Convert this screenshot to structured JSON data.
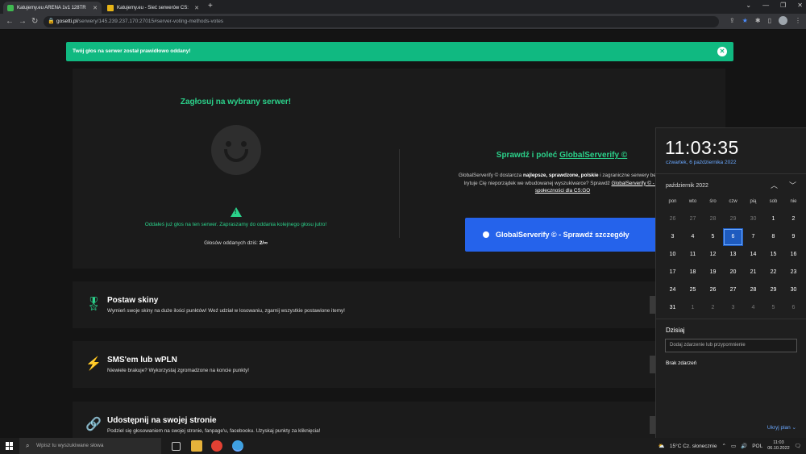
{
  "browser": {
    "tabs": [
      {
        "title": "Katujemy.eu ARENA 1v1 128TR",
        "active": true
      },
      {
        "title": "Katujemy.eu - Sieć serwerów CS:",
        "active": false
      }
    ],
    "url_domain": "gosetti.pl",
    "url_path": "/serwery/145.239.237.170:27015#server-voting-methods-votes"
  },
  "alert": {
    "text": "Twój głos na serwer został prawidłowo oddany!"
  },
  "vote": {
    "title": "Zagłosuj na wybrany serwer!",
    "already_voted": "Oddałeś już głos na ten serwer. Zapraszamy do oddania kolejnego głosu jutro!",
    "votes_today_label": "Głosów oddanych dziś:",
    "votes_today_value": "2/∞"
  },
  "globalserverify": {
    "title_prefix": "Sprawdź i poleć",
    "title_link": "GlobalServerify ©",
    "desc_1": "GlobalServerify © dostarcza",
    "desc_bold": "najlepsze, sprawdzone, polskie",
    "desc_2": "i zagraniczne serwery bezpoś",
    "desc_3": "Irytuje Cię nieporządek we wbudowanej wyszukiwarce? Sprawdź",
    "desc_link": "GlobalServerify © - do",
    "desc_link2": "społeczności dla CS:GO",
    "button": "GlobalServerify © - Sprawdź szczegóły"
  },
  "cards": [
    {
      "title": "Postaw skiny",
      "desc": "Wymień swoje skiny na duże ilości punktów! Weź udział w losowaniu, zgarnij wszystkie postawione itemy!",
      "icon": "award-icon"
    },
    {
      "title": "SMS'em lub wPLN",
      "desc": "Niewiele brakuje? Wykorzystaj zgromadzone na koncie punkty!",
      "icon": "bolt-icon"
    },
    {
      "title": "Udostępnij na swojej stronie",
      "desc": "Podziel się głosowaniem na swojej stronie, fanpage'u, facebooku. Uzyskaj punkty za kliknięcia!",
      "icon": "link-icon"
    }
  ],
  "calendar": {
    "time": "11:03:35",
    "date": "czwartek, 6 października 2022",
    "month": "październik 2022",
    "weekdays": [
      "pon",
      "wto",
      "śro",
      "czw",
      "pią",
      "sob",
      "nie"
    ],
    "days": [
      [
        "26",
        "27",
        "28",
        "29",
        "30",
        "1",
        "2"
      ],
      [
        "3",
        "4",
        "5",
        "6",
        "7",
        "8",
        "9"
      ],
      [
        "10",
        "11",
        "12",
        "13",
        "14",
        "15",
        "16"
      ],
      [
        "17",
        "18",
        "19",
        "20",
        "21",
        "22",
        "23"
      ],
      [
        "24",
        "25",
        "26",
        "27",
        "28",
        "29",
        "30"
      ],
      [
        "31",
        "1",
        "2",
        "3",
        "4",
        "5",
        "6"
      ]
    ],
    "today": "Dzisiaj",
    "event_placeholder": "Dodaj zdarzenie lub przypomnienie",
    "no_events": "Brak zdarzeń",
    "hide_plan": "Ukryj plan ⌄"
  },
  "taskbar": {
    "search_placeholder": "Wpisz tu wyszukiwane słowa",
    "weather": "15°C  Cz. słonecznie",
    "lang": "POL",
    "time": "11:03",
    "date": "06.10.2022"
  }
}
